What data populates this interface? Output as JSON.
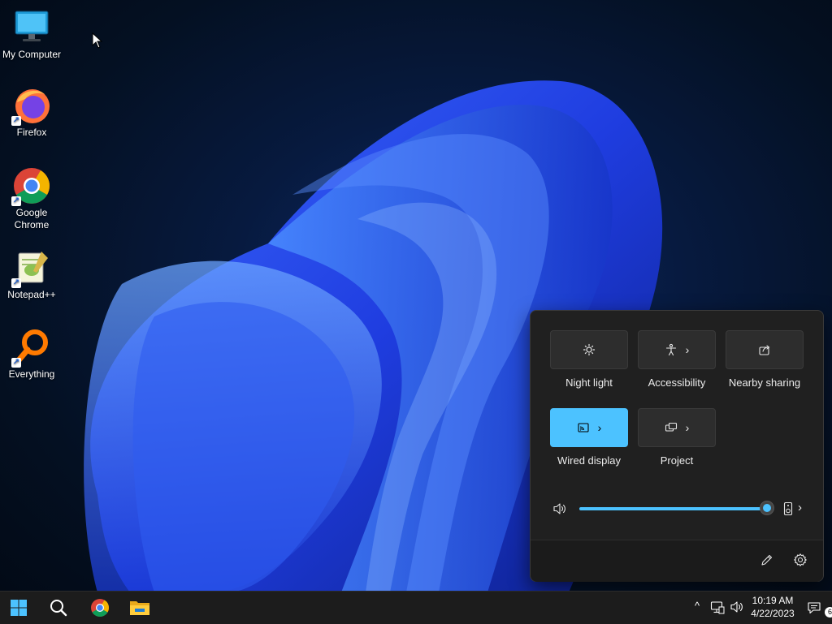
{
  "desktop": {
    "icons": [
      {
        "label": "My Computer",
        "icon": "computer-icon"
      },
      {
        "label": "Firefox",
        "icon": "firefox-icon"
      },
      {
        "label": "Google Chrome",
        "icon": "chrome-icon"
      },
      {
        "label": "Notepad++",
        "icon": "notepadpp-icon"
      },
      {
        "label": "Everything",
        "icon": "everything-icon"
      }
    ]
  },
  "quick_settings": {
    "tiles": [
      {
        "label": "Night light",
        "icon": "brightness-icon",
        "active": false,
        "has_chevron": false
      },
      {
        "label": "Accessibility",
        "icon": "accessibility-icon",
        "active": false,
        "has_chevron": true
      },
      {
        "label": "Nearby sharing",
        "icon": "share-icon",
        "active": false,
        "has_chevron": false
      },
      {
        "label": "Wired display",
        "icon": "cast-icon",
        "active": true,
        "has_chevron": true
      },
      {
        "label": "Project",
        "icon": "project-icon",
        "active": false,
        "has_chevron": true
      }
    ],
    "volume": {
      "level": 1.0,
      "icon": "speaker-icon",
      "output_icon": "audio-output-icon"
    },
    "footer": {
      "edit_icon": "pencil-icon",
      "settings_icon": "gear-icon"
    }
  },
  "taskbar": {
    "pinned": [
      "start-icon",
      "search-icon",
      "chrome-icon",
      "file-explorer-icon"
    ],
    "tray": {
      "overflow_icon": "chevron-up-icon",
      "network_icon": "network-icon",
      "volume_icon": "speaker-icon",
      "time": "10:19 AM",
      "date": "4/22/2023",
      "notifications_count": "6"
    }
  },
  "colors": {
    "accent": "#4cc2ff",
    "panel": "#202020",
    "taskbar": "#1c1c1c"
  }
}
